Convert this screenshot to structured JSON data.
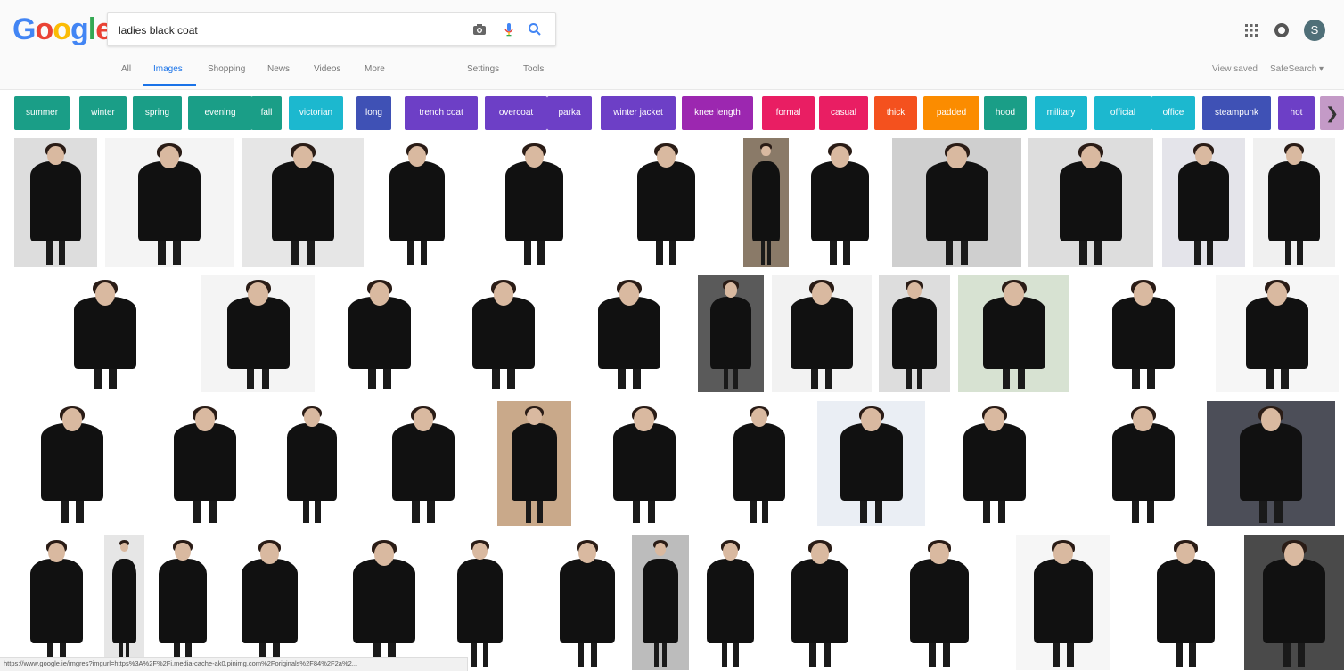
{
  "search": {
    "query": "ladies black coat"
  },
  "logo": {
    "letters": [
      "G",
      "o",
      "o",
      "g",
      "l",
      "e"
    ],
    "colors": [
      "#4285f4",
      "#ea4335",
      "#fbbc05",
      "#4285f4",
      "#34a853",
      "#ea4335"
    ]
  },
  "icons": {
    "camera": "camera-icon",
    "mic": "microphone-icon",
    "search": "search-icon",
    "apps": "apps-grid-icon",
    "notifications": "notifications-icon"
  },
  "tabs": [
    {
      "label": "All",
      "active": false
    },
    {
      "label": "Images",
      "active": true
    },
    {
      "label": "Shopping",
      "active": false
    },
    {
      "label": "News",
      "active": false
    },
    {
      "label": "Videos",
      "active": false
    },
    {
      "label": "More",
      "active": false
    },
    {
      "label": "Settings",
      "active": false
    },
    {
      "label": "Tools",
      "active": false
    }
  ],
  "account": {
    "avatar_letter": "S"
  },
  "links": {
    "view_saved": "View saved",
    "safesearch": "SafeSearch ▾"
  },
  "chips": [
    {
      "label": "summer",
      "color": "#1a9e87"
    },
    {
      "label": "winter",
      "color": "#1a9e87"
    },
    {
      "label": "spring",
      "color": "#1a9e87"
    },
    {
      "label": "evening",
      "color": "#1a9e87"
    },
    {
      "label": "fall",
      "color": "#1a9e87"
    },
    {
      "label": "victorian",
      "color": "#1cb8cf"
    },
    {
      "label": "long",
      "color": "#3f51b5"
    },
    {
      "label": "trench coat",
      "color": "#6d3fc6"
    },
    {
      "label": "overcoat",
      "color": "#6d3fc6"
    },
    {
      "label": "parka",
      "color": "#6d3fc6"
    },
    {
      "label": "winter jacket",
      "color": "#6d3fc6"
    },
    {
      "label": "knee length",
      "color": "#9c27b0"
    },
    {
      "label": "formal",
      "color": "#e91e63"
    },
    {
      "label": "casual",
      "color": "#e91e63"
    },
    {
      "label": "thick",
      "color": "#f4511e"
    },
    {
      "label": "padded",
      "color": "#fb8c00"
    },
    {
      "label": "hood",
      "color": "#1a9e87"
    },
    {
      "label": "military",
      "color": "#1cb8cf"
    },
    {
      "label": "official",
      "color": "#1cb8cf"
    },
    {
      "label": "office",
      "color": "#1cb8cf"
    },
    {
      "label": "steampunk",
      "color": "#3f51b5"
    },
    {
      "label": "hot",
      "color": "#6d3fc6"
    }
  ],
  "status_url": "https://www.google.ie/imgres?imgurl=https%3A%2F%2Fi.media-cache-ak0.pinimg.com%2Foriginals%2F84%2F2a%2..."
}
